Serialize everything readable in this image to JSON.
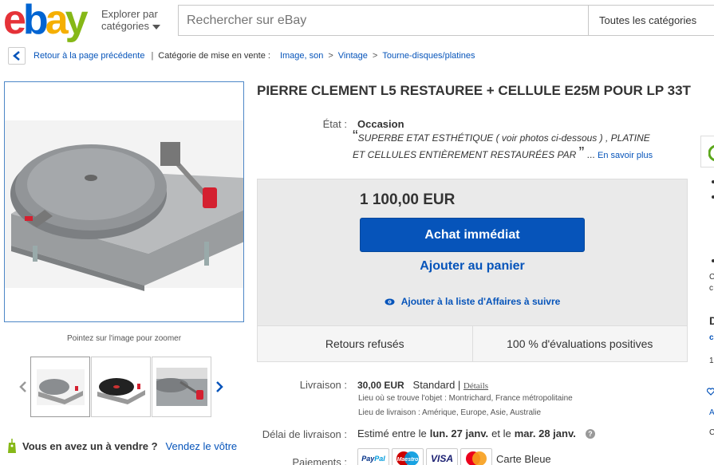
{
  "header": {
    "logo": {
      "e": "e",
      "b": "b",
      "a": "a",
      "y": "y"
    },
    "explore_line1": "Explorer par",
    "explore_line2": "catégories",
    "search_placeholder": "Rechercher sur eBay",
    "category_select": "Toutes les catégories"
  },
  "breadcrumb": {
    "back": "Retour à la page précédente",
    "category_label": "Catégorie de mise en vente :",
    "items": [
      "Image, son",
      "Vintage",
      "Tourne-disques/platines"
    ],
    "separator": ">"
  },
  "gallery": {
    "zoom_hint": "Pointez sur l'image pour zoomer"
  },
  "sell": {
    "question": "Vous en avez un à vendre ?",
    "link": "Vendez le vôtre"
  },
  "item": {
    "title": "PIERRE CLEMENT L5 RESTAUREE + CELLULE E25M POUR LP 33T",
    "condition_label": "État :",
    "condition_value": "Occasion",
    "condition_desc_line1": "SUPERBE ETAT ESTHÉTIQUE ( voir photos ci-dessous ) , PLATINE",
    "condition_desc_line2": "ET CELLULES ENTIÈREMENT RESTAURÉES PAR",
    "open_quote": "“",
    "close_quote": "”",
    "ellipsis": "...",
    "learn_more": "En savoir plus"
  },
  "buy": {
    "price": "1 100,00 EUR",
    "buy_now": "Achat immédiat",
    "add_to_cart": "Ajouter au panier",
    "watch": "Ajouter à la liste d'Affaires à suivre",
    "returns": "Retours refusés",
    "feedback": "100 % d'évaluations positives"
  },
  "shipping": {
    "label": "Livraison :",
    "cost": "30,00 EUR",
    "method": "Standard",
    "details": "Détails",
    "item_location": "Lieu où se trouve l'objet : Montrichard, France métropolitaine",
    "ship_to": "Lieu de livraison : Amérique, Europe, Asie, Australie"
  },
  "delivery": {
    "label": "Délai de livraison :",
    "prefix": "Estimé entre le",
    "date1": "lun. 27 janv.",
    "mid": "et le",
    "date2": "mar. 28 janv.",
    "help": "?"
  },
  "payments": {
    "label": "Paiements :",
    "methods": [
      "PayPal",
      "Maestro",
      "VISA",
      "MasterCard"
    ],
    "text": "Carte Bleue"
  },
  "right_col": {
    "snippets": [
      "C",
      "c",
      "D",
      "c",
      "1",
      "A",
      "C"
    ]
  },
  "colors": {
    "primary_blue": "#0654ba",
    "ebay_red": "#e53238",
    "ebay_blue": "#0064d2",
    "ebay_yellow": "#f5af02",
    "ebay_green": "#86b817",
    "paypal_blue": "#003087",
    "paypal_light": "#009cde"
  }
}
